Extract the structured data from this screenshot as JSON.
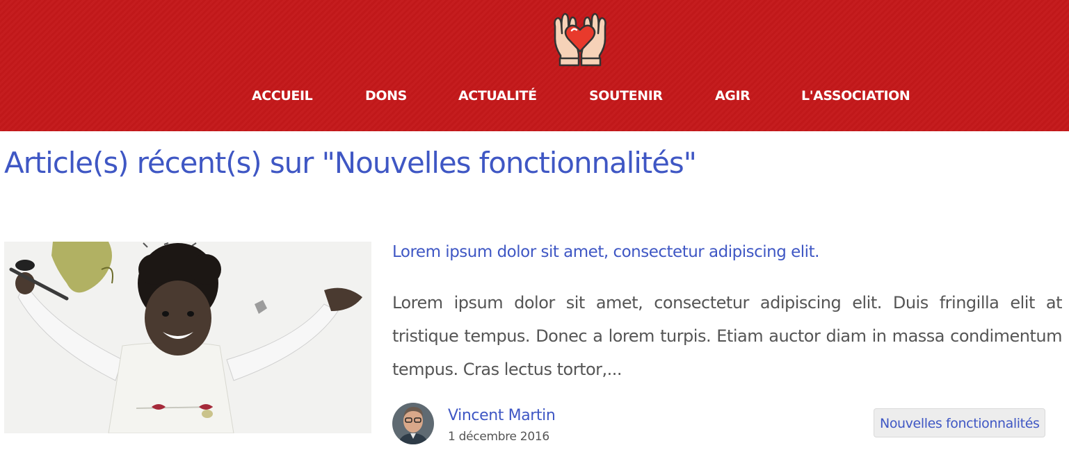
{
  "header": {
    "background_color": "#c4181a",
    "logo_icon": "hands-holding-heart-icon",
    "nav": [
      {
        "label": "ACCUEIL"
      },
      {
        "label": "DONS"
      },
      {
        "label": "ACTUALITÉ"
      },
      {
        "label": "SOUTENIR"
      },
      {
        "label": "AGIR"
      },
      {
        "label": "L'ASSOCIATION"
      }
    ]
  },
  "page": {
    "title": "Article(s) récent(s) sur \"Nouvelles fonctionnalités\""
  },
  "post": {
    "thumbnail": "girl-with-paintbrush-and-world-map-photo",
    "title": "Lorem ipsum dolor sit amet, consectetur adipiscing elit.",
    "excerpt": "Lorem ipsum dolor sit amet, consectetur adipiscing elit. Duis fringilla elit at tristique tempus. Donec a lorem turpis. Etiam auctor diam in massa condimentum tempus. Cras lectus tortor,...",
    "author": {
      "name": "Vincent Martin",
      "avatar": "author-portrait-photo"
    },
    "date": "1 décembre 2016",
    "tag": "Nouvelles fonctionnalités"
  },
  "colors": {
    "accent": "#3f57c4",
    "text": "#555555",
    "tag_bg": "#ededed"
  }
}
